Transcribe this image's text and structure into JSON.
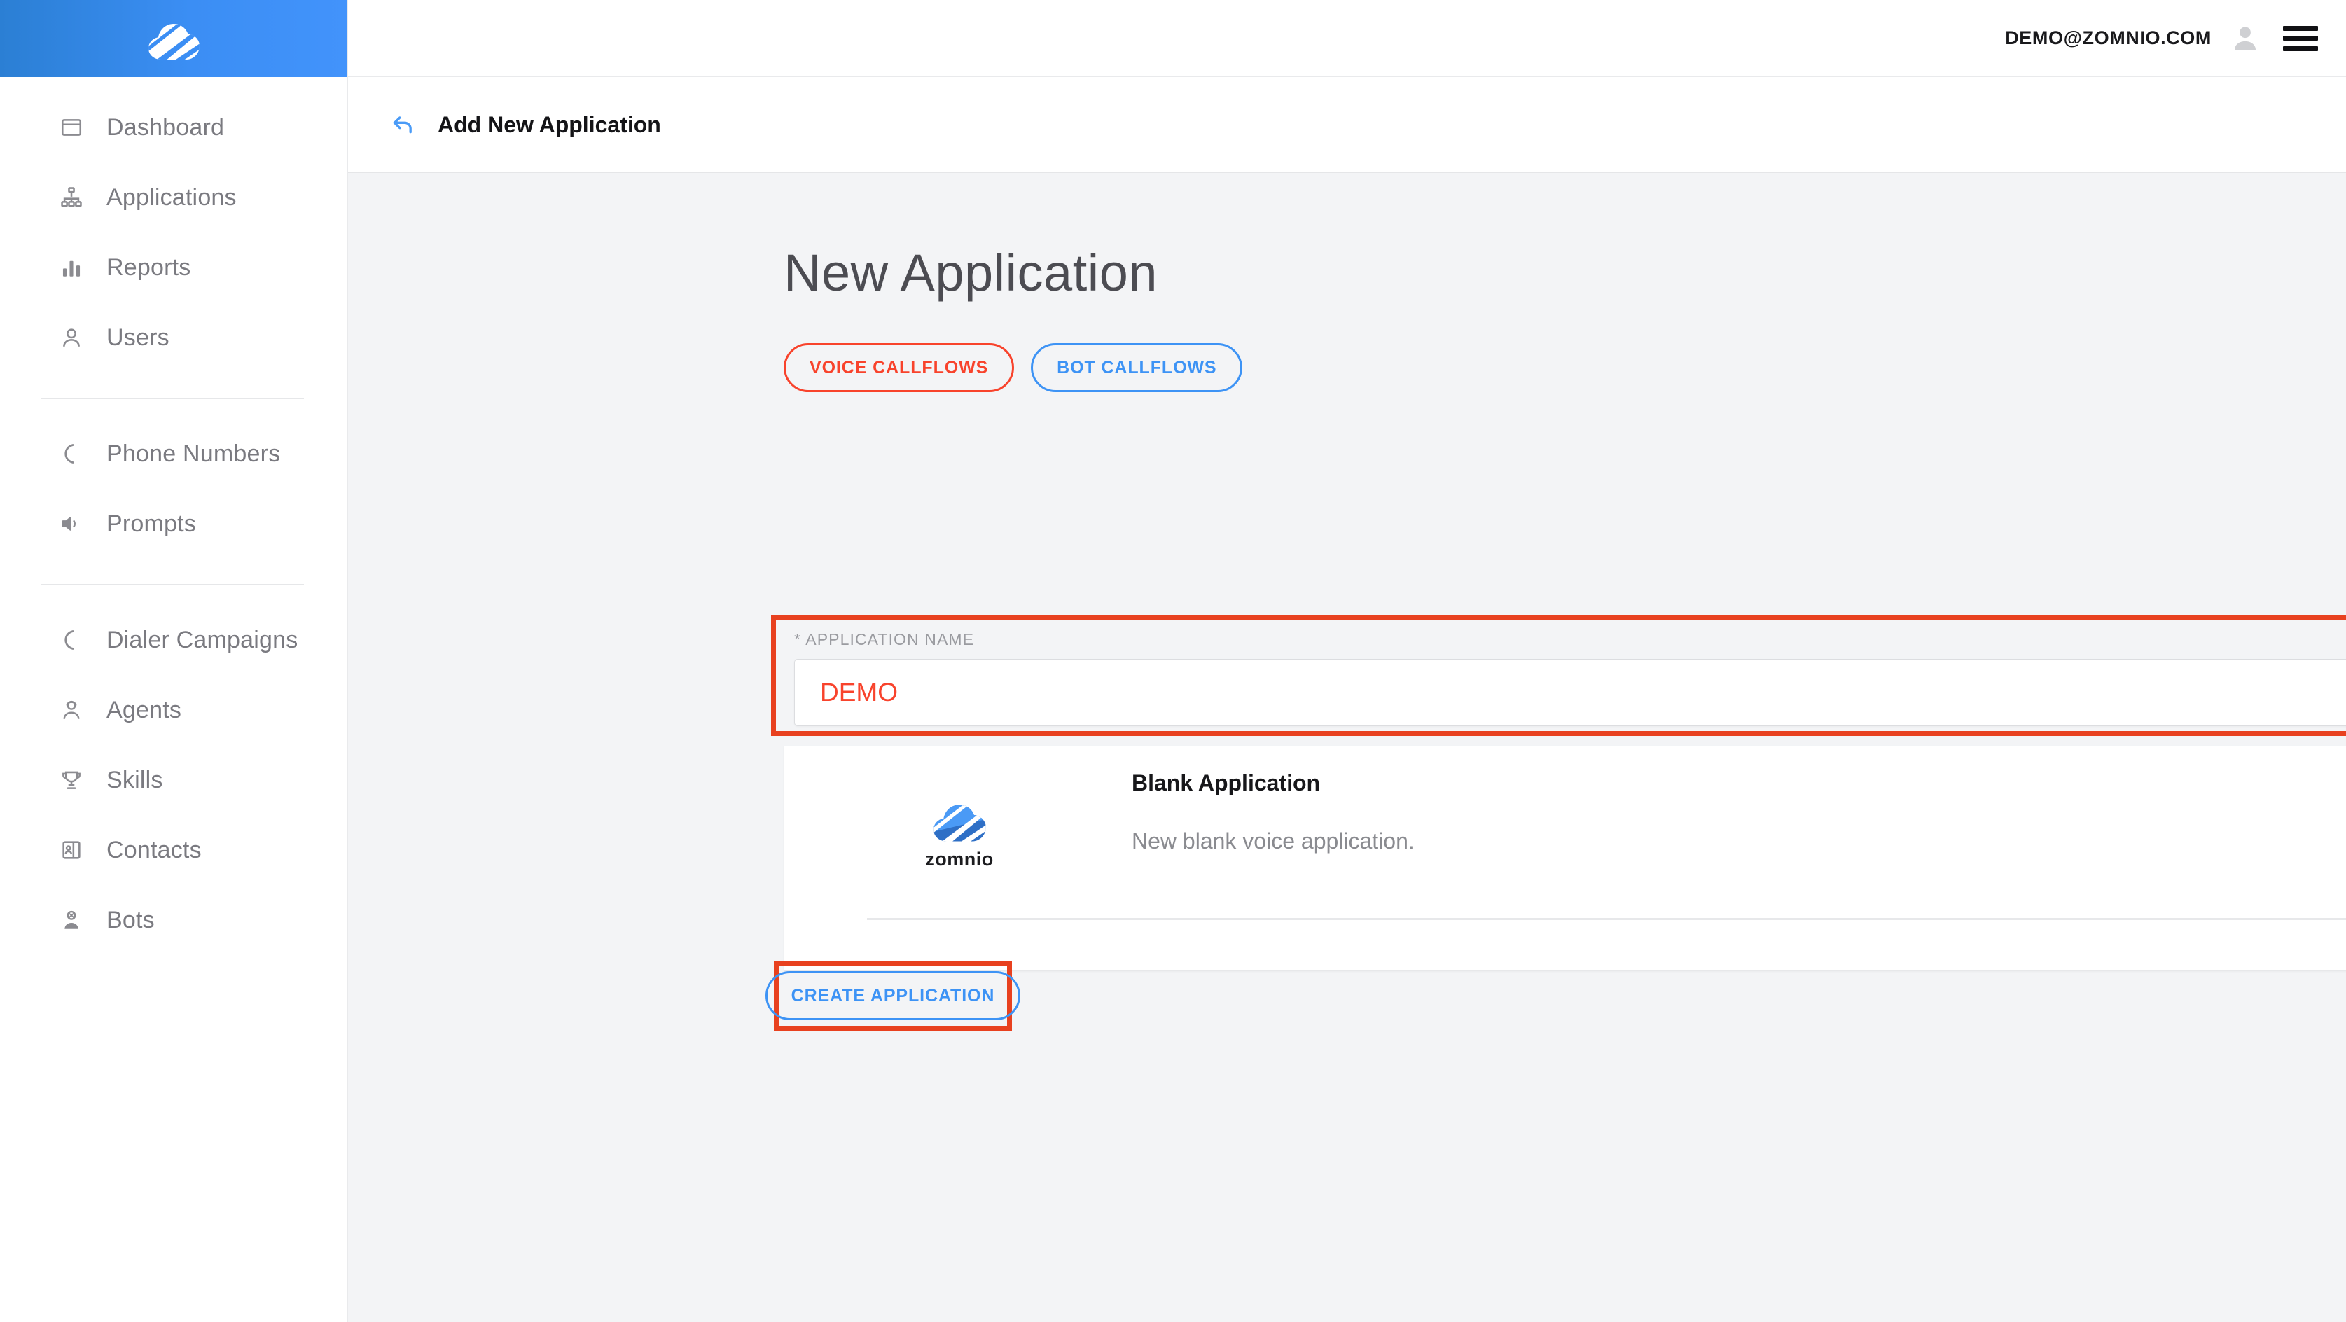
{
  "brand": {
    "logo_icon": "zomnio-cloud-logo"
  },
  "sidebar": {
    "items": [
      {
        "label": "Dashboard",
        "icon": "window-icon"
      },
      {
        "label": "Applications",
        "icon": "sitemap-icon"
      },
      {
        "label": "Reports",
        "icon": "bar-chart-icon"
      },
      {
        "label": "Users",
        "icon": "user-icon"
      },
      {
        "label": "Phone Numbers",
        "icon": "phone-icon"
      },
      {
        "label": "Prompts",
        "icon": "speaker-icon"
      },
      {
        "label": "Dialer Campaigns",
        "icon": "phone-icon"
      },
      {
        "label": "Agents",
        "icon": "agent-headset-icon"
      },
      {
        "label": "Skills",
        "icon": "trophy-icon"
      },
      {
        "label": "Contacts",
        "icon": "contact-card-icon"
      },
      {
        "label": "Bots",
        "icon": "bot-icon"
      }
    ]
  },
  "topbar": {
    "user_email": "DEMO@ZOMNIO.COM",
    "avatar_icon": "avatar-icon",
    "menu_icon": "hamburger-menu-icon"
  },
  "subbar": {
    "back_icon": "back-arrow-icon",
    "title": "Add New Application"
  },
  "main": {
    "page_title": "New Application",
    "tabs": [
      {
        "label": "VOICE CALLFLOWS",
        "color": "#f8432c",
        "active": true
      },
      {
        "label": "BOT CALLFLOWS",
        "color": "#3d93f5",
        "active": false
      }
    ],
    "name_field": {
      "label": "* APPLICATION NAME",
      "value": "DEMO",
      "placeholder": ""
    },
    "template_card": {
      "logo_icon": "zomnio-cloud-logo",
      "logo_wordmark": "zomnio",
      "title": "Blank Application",
      "description": "New blank voice application.",
      "radio_icon": "radio-selected-icon"
    },
    "create_button": {
      "label": "CREATE APPLICATION"
    }
  },
  "colors": {
    "brand_blue": "#3d93f5",
    "brand_blue_dark": "#2b7fd4",
    "accent_red": "#f8432c",
    "annotation_red": "#e8411f",
    "page_bg": "#f3f4f6",
    "text_muted": "#8a8b90"
  }
}
